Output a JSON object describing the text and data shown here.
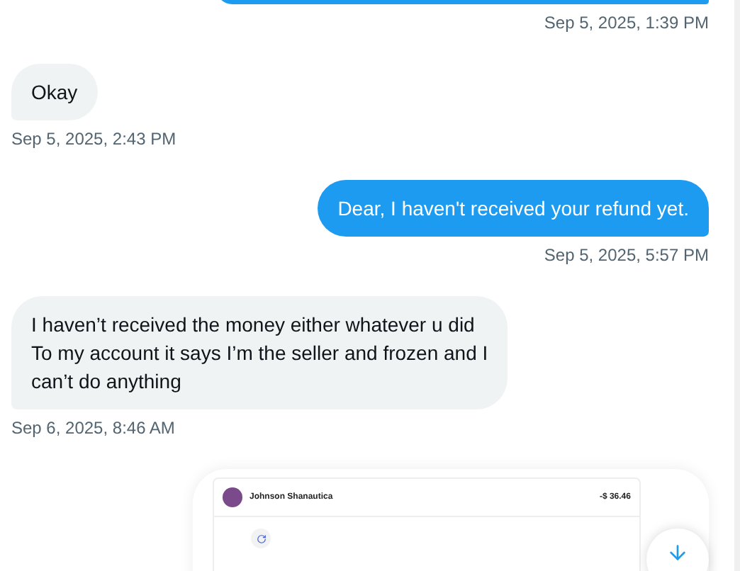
{
  "messages": [
    {
      "outgoing": true,
      "kind": "text",
      "time": "Sep 5, 2025, 1:39 PM"
    },
    {
      "outgoing": false,
      "kind": "text",
      "text": "Okay",
      "time": "Sep 5, 2025, 2:43 PM"
    },
    {
      "outgoing": true,
      "kind": "text",
      "text": "Dear, I haven't received your refund yet.",
      "time": "Sep 5, 2025, 5:57 PM"
    },
    {
      "outgoing": false,
      "kind": "text",
      "lines": [
        "I haven’t received the money either whatever u did",
        "To my account it says I’m the seller and frozen and I",
        "can’t do anything"
      ],
      "time": "Sep 6, 2025, 8:46 AM"
    },
    {
      "outgoing": true,
      "kind": "attachment",
      "name": "Johnson Shanautica",
      "amount": "-$ 36.46"
    }
  ]
}
